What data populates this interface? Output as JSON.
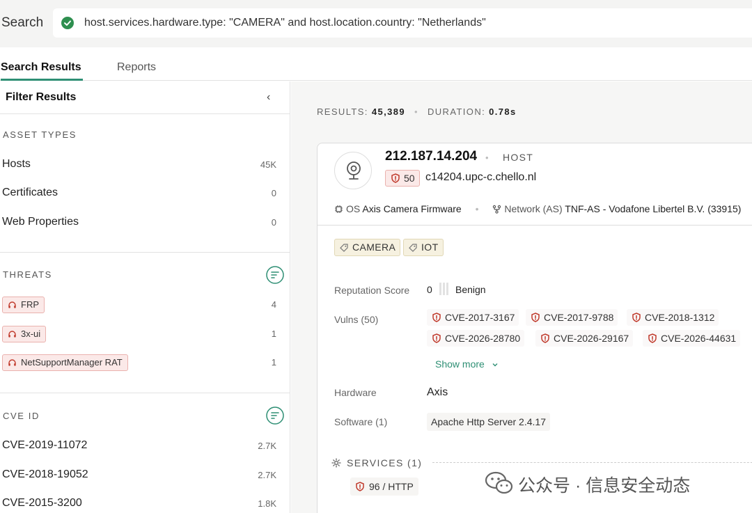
{
  "search": {
    "label": "Search",
    "query": "host.services.hardware.type: \"CAMERA\" and host.location.country: \"Netherlands\""
  },
  "tabs": [
    {
      "label": "Search Results"
    },
    {
      "label": "Reports"
    }
  ],
  "sidebar": {
    "title": "Filter Results",
    "asset_types": {
      "title": "ASSET TYPES",
      "items": [
        {
          "label": "Hosts",
          "count": "45K"
        },
        {
          "label": "Certificates",
          "count": "0"
        },
        {
          "label": "Web Properties",
          "count": "0"
        }
      ]
    },
    "threats": {
      "title": "THREATS",
      "items": [
        {
          "label": "FRP",
          "count": "4"
        },
        {
          "label": "3x-ui",
          "count": "1"
        },
        {
          "label": "NetSupportManager RAT",
          "count": "1"
        }
      ]
    },
    "cve": {
      "title": "CVE ID",
      "items": [
        {
          "label": "CVE-2019-11072",
          "count": "2.7K"
        },
        {
          "label": "CVE-2018-19052",
          "count": "2.7K"
        },
        {
          "label": "CVE-2015-3200",
          "count": "1.8K"
        }
      ]
    }
  },
  "results": {
    "results_label": "RESULTS:",
    "results_value": "45,389",
    "duration_label": "DURATION:",
    "duration_value": "0.78s"
  },
  "host": {
    "ip": "212.187.14.204",
    "type": "HOST",
    "score": "50",
    "hostname": "c14204.upc-c.chello.nl",
    "os_label": "OS",
    "os_value": "Axis Camera Firmware",
    "network_label": "Network (AS)",
    "network_value": "TNF-AS - Vodafone Libertel B.V. (33915)",
    "tags": [
      "CAMERA",
      "IOT"
    ],
    "reputation_label": "Reputation Score",
    "reputation_score": "0",
    "reputation_text": "Benign",
    "vulns_label": "Vulns (50)",
    "vulns": [
      "CVE-2017-3167",
      "CVE-2017-9788",
      "CVE-2018-1312",
      "CVE-2026-28780",
      "CVE-2026-29167",
      "CVE-2026-44631"
    ],
    "show_more": "Show more",
    "hardware_label": "Hardware",
    "hardware_value": "Axis",
    "software_label": "Software (1)",
    "software_value": "Apache Http Server 2.4.17",
    "services_label": "SERVICES (1)",
    "service_chip": "96 / HTTP"
  },
  "watermark": "公众号 · 信息安全动态",
  "colors": {
    "accent": "#2e8f74",
    "threat_bg": "#fbe9e8",
    "threat_border": "#eab1ad",
    "tag_bg": "#f6f1e0",
    "danger": "#c0392b"
  },
  "icons": {
    "valid": "check-circle-icon",
    "collapse": "chevron-left-icon",
    "sort": "sort-lines-icon",
    "threat": "headset-icon",
    "camera": "webcam-icon",
    "shield": "shield-icon",
    "chip": "chip-icon",
    "network": "network-icon",
    "tag": "tag-icon",
    "chevron": "chevron-down-icon",
    "gear": "gear-icon",
    "wechat": "wechat-icon"
  }
}
